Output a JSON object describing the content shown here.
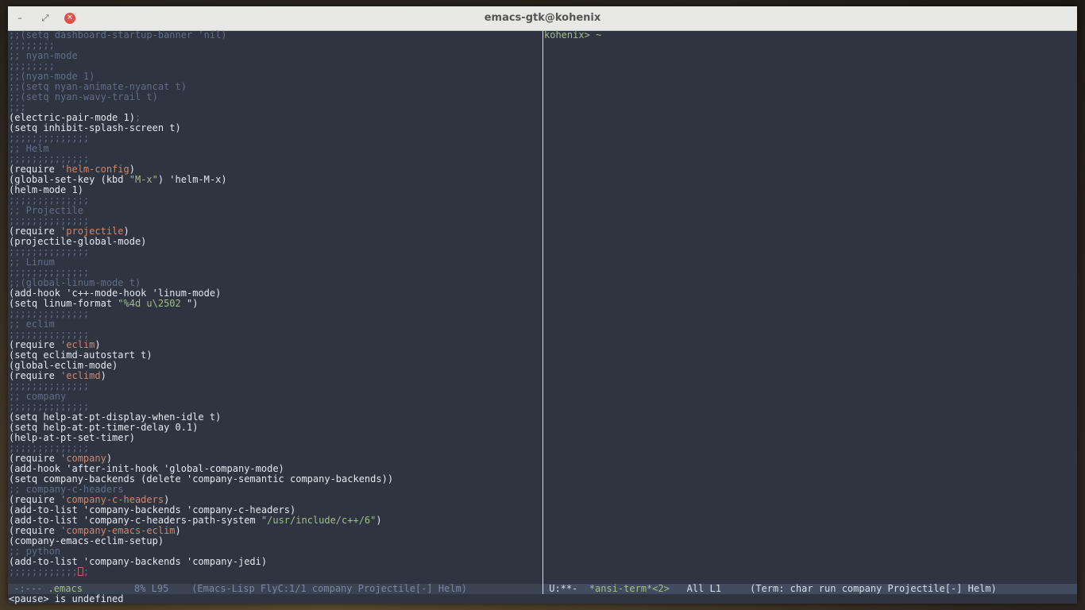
{
  "window": {
    "title": "emacs-gtk@kohenix",
    "minimize_icon": "minimize-icon",
    "maximize_icon": "maximize-icon",
    "close_icon": "close-icon",
    "minimize_glyph": "–",
    "maximize_glyph": "⤢",
    "close_glyph": "✕"
  },
  "editor": {
    "lines": [
      [
        {
          "t": ";;(setq dashboard-startup-banner 'nil)",
          "c": "comment"
        }
      ],
      [
        {
          "t": ";;;;;;;;",
          "c": "comment"
        }
      ],
      [
        {
          "t": ";; nyan-mode",
          "c": "comment"
        }
      ],
      [
        {
          "t": ";;;;;;;;",
          "c": "comment"
        }
      ],
      [
        {
          "t": ";;(nyan-mode 1)",
          "c": "comment"
        }
      ],
      [
        {
          "t": ";;(setq nyan-animate-nyancat t)",
          "c": "comment"
        }
      ],
      [
        {
          "t": ";;(setq nyan-wavy-trail t)",
          "c": "comment"
        }
      ],
      [
        {
          "t": ";;;",
          "c": "comment"
        }
      ],
      [
        {
          "t": "(electric-pair-mode 1)",
          "c": "default"
        },
        {
          "t": ";",
          "c": "comment"
        }
      ],
      [
        {
          "t": "(setq inhibit-splash-screen t)",
          "c": "default"
        }
      ],
      [
        {
          "t": ";;;;;;;;;;;;;;",
          "c": "comment"
        }
      ],
      [
        {
          "t": ";; Helm",
          "c": "comment"
        }
      ],
      [
        {
          "t": ";;;;;;;;;;;;;;",
          "c": "comment"
        }
      ],
      [
        {
          "t": "(require ",
          "c": "default"
        },
        {
          "t": "'helm-config",
          "c": "quote"
        },
        {
          "t": ")",
          "c": "default"
        }
      ],
      [
        {
          "t": "(global-set-key (kbd ",
          "c": "default"
        },
        {
          "t": "\"M-x\"",
          "c": "string"
        },
        {
          "t": ") 'helm-M-x)",
          "c": "default"
        }
      ],
      [
        {
          "t": "(helm-mode 1)",
          "c": "default"
        }
      ],
      [
        {
          "t": ";;;;;;;;;;;;;;",
          "c": "comment"
        }
      ],
      [
        {
          "t": ";; Projectile",
          "c": "comment"
        }
      ],
      [
        {
          "t": ";;;;;;;;;;;;;;",
          "c": "comment"
        }
      ],
      [
        {
          "t": "(require ",
          "c": "default"
        },
        {
          "t": "'projectile",
          "c": "quote"
        },
        {
          "t": ")",
          "c": "default"
        }
      ],
      [
        {
          "t": "(projectile-global-mode)",
          "c": "default"
        }
      ],
      [
        {
          "t": ";;;;;;;;;;;;;;",
          "c": "comment"
        }
      ],
      [
        {
          "t": ";; Linum",
          "c": "comment"
        }
      ],
      [
        {
          "t": ";;;;;;;;;;;;;;",
          "c": "comment"
        }
      ],
      [
        {
          "t": ";;(global-linum-mode t)",
          "c": "comment"
        }
      ],
      [
        {
          "t": "(add-hook 'c++-mode-hook 'linum-mode)",
          "c": "default"
        }
      ],
      [
        {
          "t": "(setq linum-format ",
          "c": "default"
        },
        {
          "t": "\"%4d u\\2502 ",
          "c": "string"
        },
        {
          "t": "\")",
          "c": "default"
        }
      ],
      [
        {
          "t": ";;;;;;;;;;;;;;",
          "c": "comment"
        }
      ],
      [
        {
          "t": ";; eclim",
          "c": "comment"
        }
      ],
      [
        {
          "t": ";;;;;;;;;;;;;;",
          "c": "comment"
        }
      ],
      [
        {
          "t": "(require ",
          "c": "default"
        },
        {
          "t": "'eclim",
          "c": "quote"
        },
        {
          "t": ")",
          "c": "default"
        }
      ],
      [
        {
          "t": "(setq eclimd-autostart t)",
          "c": "default"
        }
      ],
      [
        {
          "t": "(global-eclim-mode)",
          "c": "default"
        }
      ],
      [
        {
          "t": "(require ",
          "c": "default"
        },
        {
          "t": "'eclimd",
          "c": "quote"
        },
        {
          "t": ")",
          "c": "default"
        }
      ],
      [
        {
          "t": ";;;;;;;;;;;;;;",
          "c": "comment"
        }
      ],
      [
        {
          "t": ";; company",
          "c": "comment"
        }
      ],
      [
        {
          "t": ";;;;;;;;;;;;;;",
          "c": "comment"
        }
      ],
      [
        {
          "t": "(setq help-at-pt-display-when-idle t)",
          "c": "default"
        }
      ],
      [
        {
          "t": "(setq help-at-pt-timer-delay 0.1)",
          "c": "default"
        }
      ],
      [
        {
          "t": "(help-at-pt-set-timer)",
          "c": "default"
        }
      ],
      [
        {
          "t": ";;;;;;;;;;;;;;",
          "c": "comment"
        }
      ],
      [
        {
          "t": "(require ",
          "c": "default"
        },
        {
          "t": "'company",
          "c": "quote"
        },
        {
          "t": ")",
          "c": "default"
        }
      ],
      [
        {
          "t": "(add-hook 'after-init-hook 'global-company-mode)",
          "c": "default"
        }
      ],
      [
        {
          "t": "(setq company-backends (delete 'company-semantic company-backends))",
          "c": "default"
        }
      ],
      [
        {
          "t": ";; company-c-headers",
          "c": "comment"
        }
      ],
      [
        {
          "t": "(require ",
          "c": "default"
        },
        {
          "t": "'company-c-headers",
          "c": "quote"
        },
        {
          "t": ")",
          "c": "default"
        }
      ],
      [
        {
          "t": "(add-to-list 'company-backends 'company-c-headers)",
          "c": "default"
        }
      ],
      [
        {
          "t": "(add-to-list 'company-c-headers-path-system ",
          "c": "default"
        },
        {
          "t": "\"/usr/include/c++/6\"",
          "c": "string"
        },
        {
          "t": ")",
          "c": "default"
        }
      ],
      [
        {
          "t": "(require ",
          "c": "default"
        },
        {
          "t": "'company-emacs-eclim",
          "c": "quote"
        },
        {
          "t": ")",
          "c": "default"
        }
      ],
      [
        {
          "t": "(company-emacs-eclim-setup)",
          "c": "default"
        }
      ],
      [
        {
          "t": ";; python",
          "c": "comment"
        }
      ],
      [
        {
          "t": "(add-to-list 'company-backends 'company-jedi)",
          "c": "default"
        }
      ],
      [
        {
          "t": ";;;;;;;;;;;;",
          "c": "comment"
        },
        {
          "t": "",
          "c": "cursor"
        },
        {
          "t": ";",
          "c": "comment"
        }
      ]
    ]
  },
  "terminal": {
    "prompt": "kohenix> ~"
  },
  "modeline_left": {
    "prefix": " -:--- ",
    "buffer": ".emacs",
    "rest": "         8% L95    (Emacs-Lisp FlyC:1/1 company Projectile[-] Helm)"
  },
  "modeline_right": {
    "prefix": " U:**-  ",
    "buffer": "*ansi-term*<2>",
    "rest": "   All L1     (Term: char run company Projectile[-] Helm)"
  },
  "echo_area": {
    "message": "<pause> is undefined"
  }
}
